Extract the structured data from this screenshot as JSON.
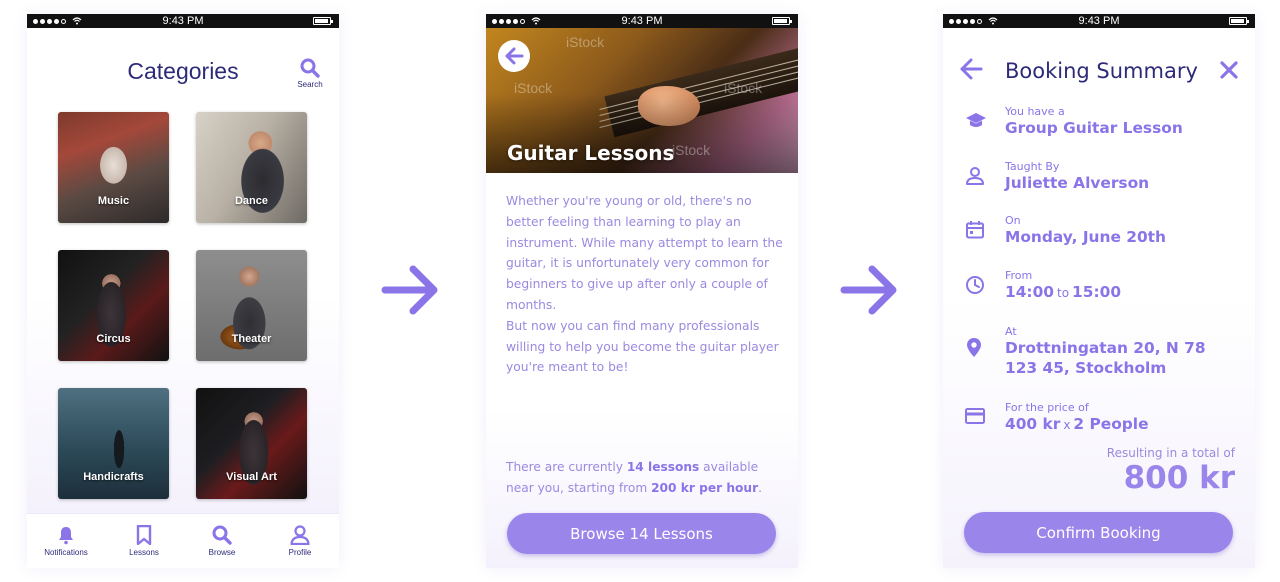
{
  "status_bar": {
    "time": "9:43 PM"
  },
  "categories_screen": {
    "title": "Categories",
    "search_label": "Search",
    "tiles": [
      {
        "label": "Music"
      },
      {
        "label": "Dance"
      },
      {
        "label": "Circus"
      },
      {
        "label": "Theater"
      },
      {
        "label": "Handicrafts"
      },
      {
        "label": "Visual Art"
      }
    ],
    "tabs": [
      {
        "label": "Notifications",
        "icon": "bell-icon"
      },
      {
        "label": "Lessons",
        "icon": "bookmark-icon"
      },
      {
        "label": "Browse",
        "icon": "search-icon"
      },
      {
        "label": "Profile",
        "icon": "user-icon"
      }
    ]
  },
  "lesson_screen": {
    "title": "Guitar Lessons",
    "description": "Whether you're young or old, there's no better feeling than learning to play an instrument. While many attempt to learn the guitar, it is unfortunately very common for beginners to give up after only a couple of months.\nBut now you can find many professionals willing to help you become the guitar player you're meant to be!",
    "availability": {
      "prefix": "There are currently",
      "count_text": "14 lessons",
      "middle": "available near you, starting from",
      "price_text": "200 kr per hour",
      "suffix": "."
    },
    "cta_label": "Browse 14 Lessons",
    "watermark": "iStock"
  },
  "summary_screen": {
    "title": "Booking Summary",
    "rows": [
      {
        "caption": "You have a",
        "value": "Group Guitar Lesson",
        "icon": "graduation-cap-icon"
      },
      {
        "caption": "Taught By",
        "value": "Juliette Alverson",
        "icon": "person-icon"
      },
      {
        "caption": "On",
        "value": "Monday, June 20th",
        "icon": "calendar-icon"
      },
      {
        "caption": "From",
        "value_start": "14:00",
        "connector": "to",
        "value_end": "15:00",
        "icon": "clock-icon"
      },
      {
        "caption": "At",
        "value": "Drottningatan 20, N 78",
        "value_line2": "123 45, Stockholm",
        "icon": "location-pin-icon"
      },
      {
        "caption": "For the price of",
        "value_start": "400 kr",
        "connector": "x",
        "value_end": "2 People",
        "icon": "credit-card-icon"
      }
    ],
    "total_caption": "Resulting in a total of",
    "total_value": "800 kr",
    "cta_label": "Confirm Booking"
  },
  "colors": {
    "accent": "#8a74e8",
    "button": "#9a85ea",
    "title_dark": "#2d2a78",
    "body_text": "#9b89e0"
  }
}
